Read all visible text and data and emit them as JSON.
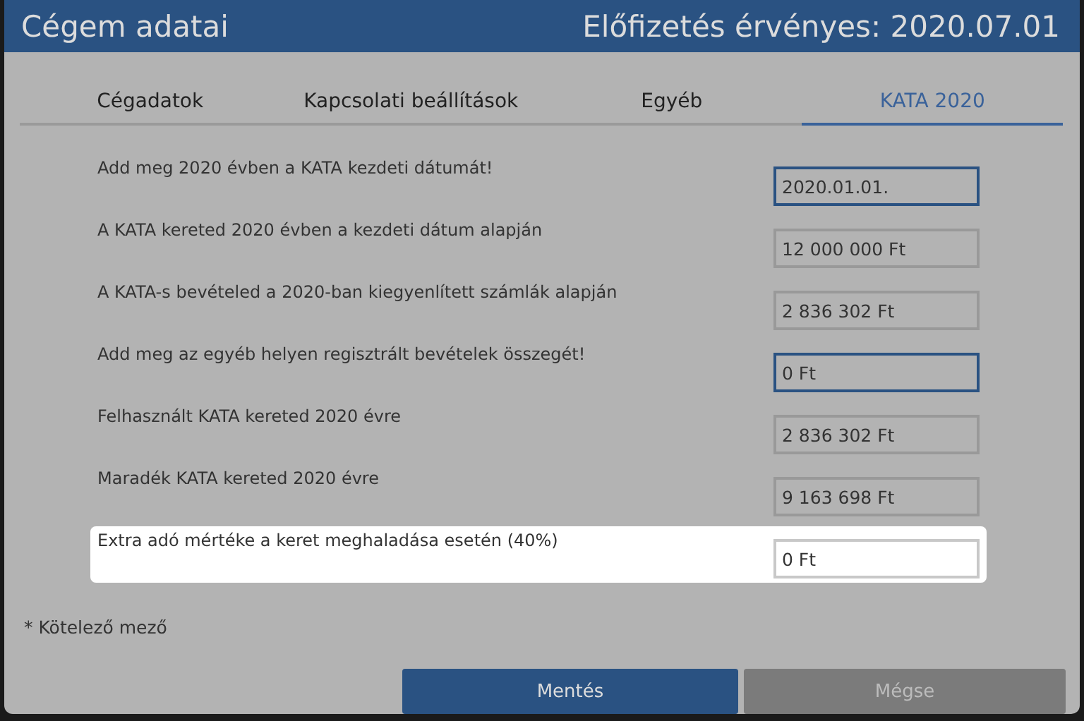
{
  "window": {
    "title": "Cégem adatai",
    "subscription": "Előfizetés érvényes: 2020.07.01"
  },
  "tabs": [
    {
      "label": "Cégadatok",
      "selected": false
    },
    {
      "label": "Kapcsolati beállítások",
      "selected": false
    },
    {
      "label": "Egyéb",
      "selected": false
    },
    {
      "label": "KATA 2020",
      "selected": true
    }
  ],
  "rows": [
    {
      "label": "Add meg 2020 évben a KATA kezdeti dátumát!",
      "value": "2020.01.01.",
      "kind": "input",
      "highlighted": false
    },
    {
      "label": "A KATA kereted 2020 évben a kezdeti dátum alapján",
      "value": "12 000 000 Ft",
      "kind": "readonly",
      "highlighted": false
    },
    {
      "label": "A KATA-s bevételed a 2020-ban kiegyenlített számlák alapján",
      "value": "2 836 302 Ft",
      "kind": "readonly",
      "highlighted": false
    },
    {
      "label": "Add meg az egyéb helyen regisztrált bevételek összegét!",
      "value": "0 Ft",
      "kind": "input",
      "highlighted": false
    },
    {
      "label": "Felhasznált KATA kereted 2020 évre",
      "value": "2 836 302 Ft",
      "kind": "readonly",
      "highlighted": false
    },
    {
      "label": "Maradék KATA kereted 2020 évre",
      "value": "9 163 698 Ft",
      "kind": "readonly",
      "highlighted": false
    },
    {
      "label": "Extra adó mértéke a keret meghaladása esetén (40%)",
      "value": "0 Ft",
      "kind": "readonly",
      "highlighted": true
    }
  ],
  "required_note": "* Kötelező mező",
  "buttons": [
    {
      "label": "Mentés",
      "kind": "primary",
      "disabled": false
    },
    {
      "label": "Mégse",
      "kind": "secondary",
      "disabled": true
    }
  ]
}
